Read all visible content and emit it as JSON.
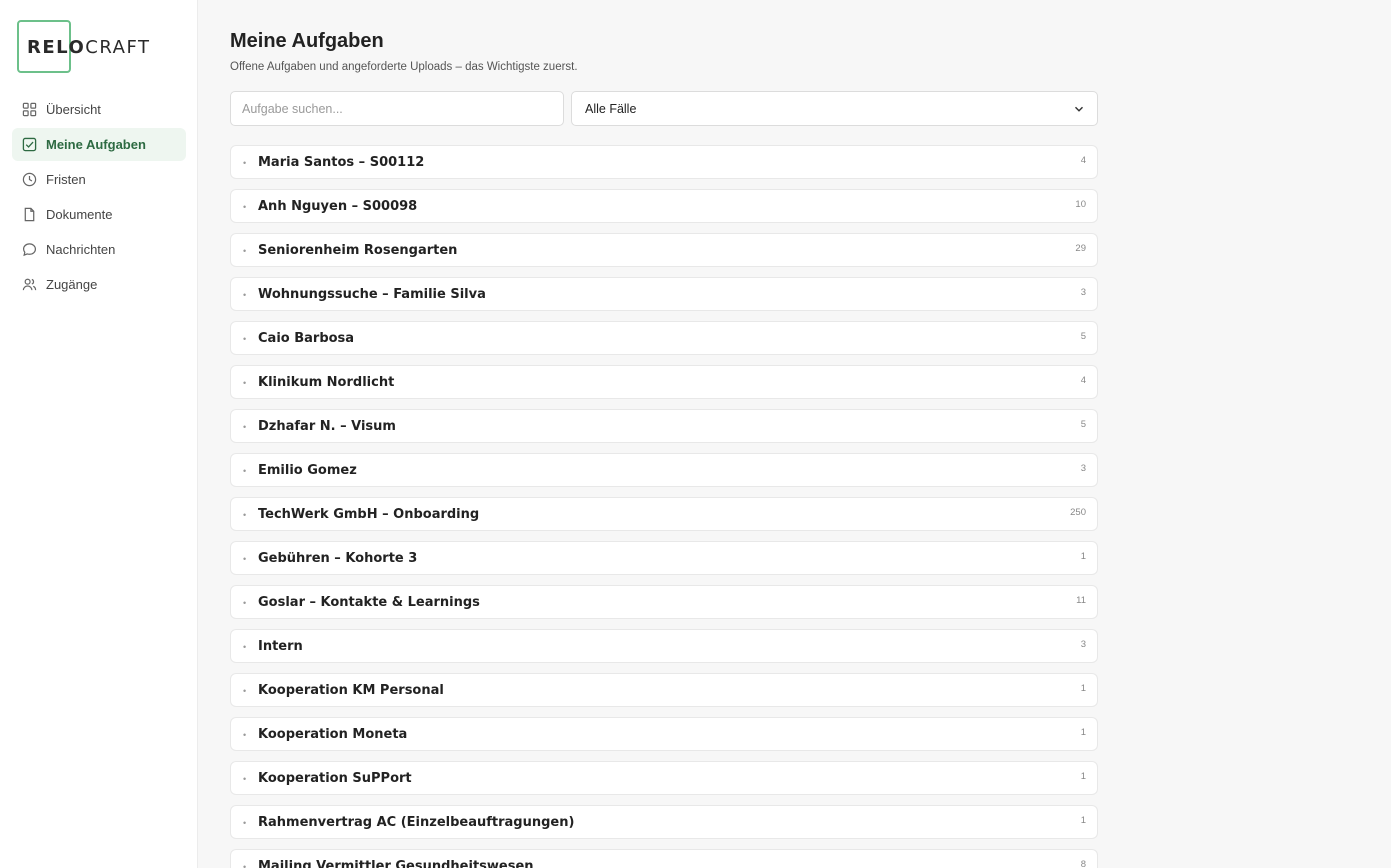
{
  "brand": {
    "logo_part1": "RELO",
    "logo_part2": "CRAFT",
    "accent": "#6cc08a"
  },
  "sidebar": {
    "items": [
      {
        "label": "Übersicht",
        "icon": "grid-icon",
        "active": false
      },
      {
        "label": "Meine Aufgaben",
        "icon": "checkbox-icon",
        "active": true
      },
      {
        "label": "Fristen",
        "icon": "clock-icon",
        "active": false
      },
      {
        "label": "Dokumente",
        "icon": "document-icon",
        "active": false
      },
      {
        "label": "Nachrichten",
        "icon": "chat-icon",
        "active": false
      },
      {
        "label": "Zugänge",
        "icon": "users-icon",
        "active": false
      }
    ]
  },
  "page": {
    "title": "Meine Aufgaben",
    "subtitle": "Offene Aufgaben und angeforderte Uploads – das Wichtigste zuerst."
  },
  "filters": {
    "search_placeholder": "Aufgabe suchen...",
    "case_select": "Alle Fälle"
  },
  "tasks": [
    {
      "name": "Maria Santos – S00112",
      "count": "4"
    },
    {
      "name": "Anh Nguyen – S00098",
      "count": "10"
    },
    {
      "name": "Seniorenheim Rosengarten",
      "count": "29"
    },
    {
      "name": "Wohnungssuche – Familie Silva",
      "count": "3"
    },
    {
      "name": "Caio Barbosa",
      "count": "5"
    },
    {
      "name": "Klinikum Nordlicht",
      "count": "4"
    },
    {
      "name": "Dzhafar N. – Visum",
      "count": "5"
    },
    {
      "name": "Emilio Gomez",
      "count": "3"
    },
    {
      "name": "TechWerk GmbH – Onboarding",
      "count": "250"
    },
    {
      "name": "Gebühren – Kohorte 3",
      "count": "1"
    },
    {
      "name": "Goslar – Kontakte & Learnings",
      "count": "11"
    },
    {
      "name": "Intern",
      "count": "3"
    },
    {
      "name": "Kooperation KM Personal",
      "count": "1"
    },
    {
      "name": "Kooperation Moneta",
      "count": "1"
    },
    {
      "name": "Kooperation SuPPort",
      "count": "1"
    },
    {
      "name": "Rahmenvertrag AC (Einzelbeauftragungen)",
      "count": "1"
    },
    {
      "name": "Mailing Vermittler Gesundheitswesen",
      "count": "8"
    }
  ]
}
